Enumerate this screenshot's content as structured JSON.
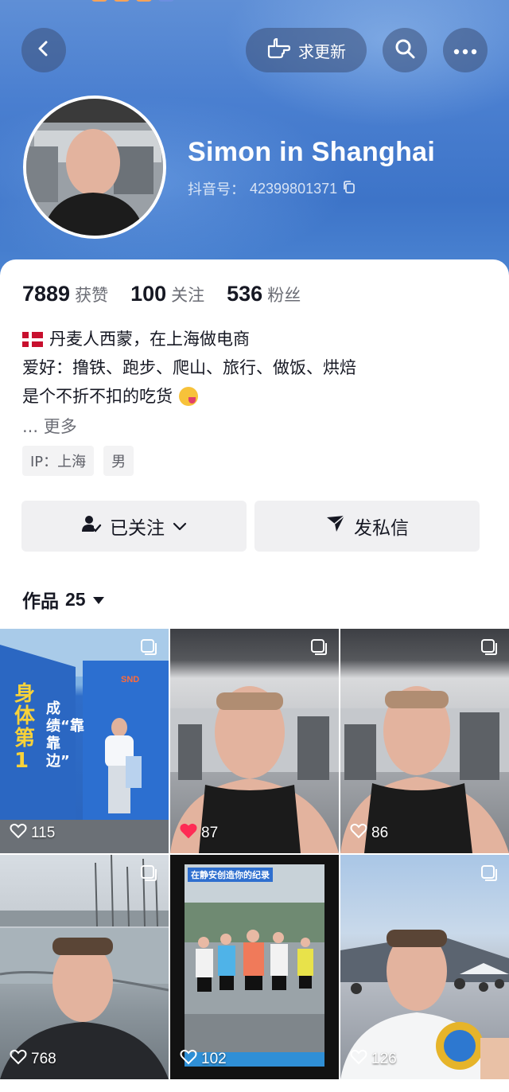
{
  "header": {
    "update_label": "求更新",
    "name": "Simon in Shanghai",
    "douyin_id_label": "抖音号：",
    "douyin_id": "42399801371"
  },
  "icons": {
    "back": "chevron-left-icon",
    "update": "pointing-hand-icon",
    "search": "search-icon",
    "more": "more-dots-icon",
    "copy": "copy-icon",
    "flag": "denmark-flag-icon",
    "emoji": "yum-emoji-icon",
    "follow": "user-check-icon",
    "message": "send-icon",
    "heart": "heart-icon",
    "multi": "multi-image-icon"
  },
  "stats": [
    {
      "value": "7889",
      "label": "获赞"
    },
    {
      "value": "100",
      "label": "关注"
    },
    {
      "value": "536",
      "label": "粉丝"
    }
  ],
  "bio": {
    "line1": "丹麦人西蒙，在上海做电商",
    "line2": "爱好：撸铁、跑步、爬山、旅行、做饭、烘焙",
    "line3": "是个不折不扣的吃货",
    "more": "... 更多"
  },
  "tags": [
    "IP：上海",
    "男"
  ],
  "actions": {
    "followed": "已关注",
    "message": "发私信"
  },
  "works": {
    "label": "作品",
    "count": "25"
  },
  "posts": [
    {
      "likes": "115",
      "liked": false,
      "poster_text_1": "身体第1",
      "poster_text_2": "成绩“靠靠边”",
      "poster_brand": "SND"
    },
    {
      "likes": "87",
      "liked": true
    },
    {
      "likes": "86",
      "liked": false
    },
    {
      "likes": "768",
      "liked": false
    },
    {
      "likes": "102",
      "liked": false,
      "caption": "在静安创造你的纪录"
    },
    {
      "likes": "126",
      "liked": false
    }
  ],
  "colors": {
    "header_blue": "#4a7fd0",
    "liked_heart": "#fe2c55",
    "text_primary": "#161823",
    "text_secondary": "#6b6d75"
  }
}
